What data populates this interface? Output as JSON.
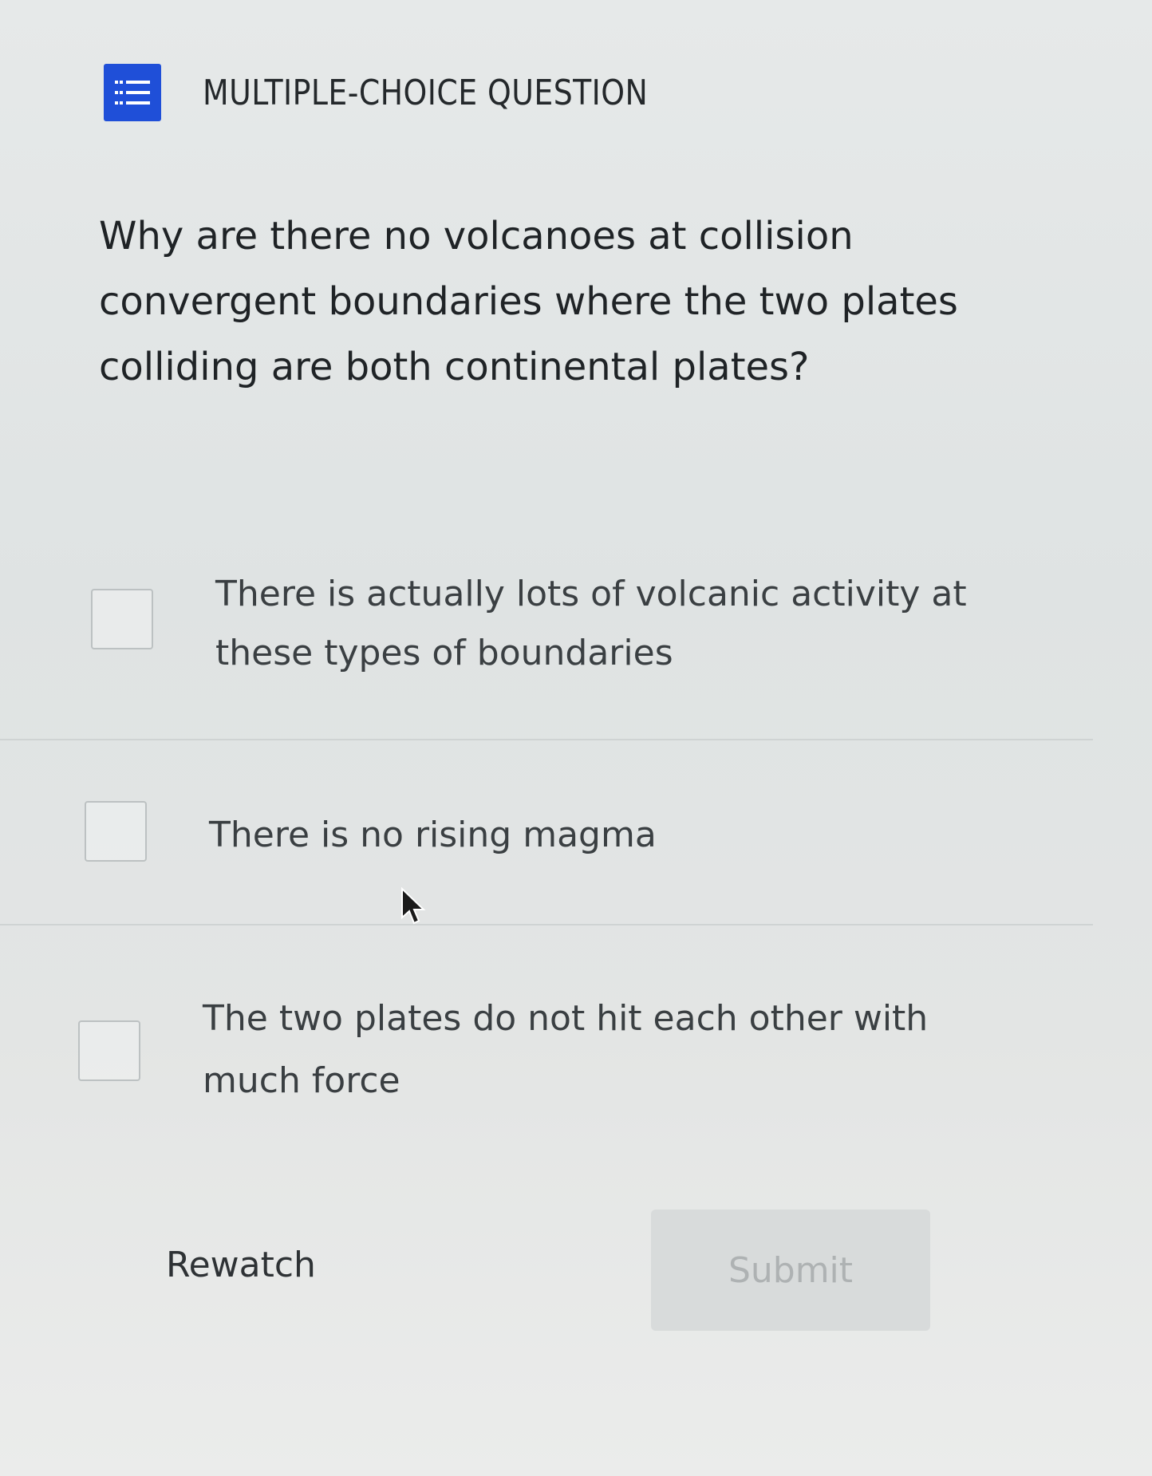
{
  "header": {
    "icon": "list-checks-icon",
    "title": "MULTIPLE-CHOICE QUESTION",
    "icon_color": "#1f4fd8"
  },
  "question": {
    "text": "Why are there no volcanoes at collision convergent boundaries where the two plates colliding are both continental plates?"
  },
  "options": [
    {
      "label": "There is actually lots of volcanic activity at these types of boundaries",
      "checked": false
    },
    {
      "label": "There is no rising magma",
      "checked": false
    },
    {
      "label": "The two plates do not hit each other with much force",
      "checked": false
    }
  ],
  "actions": {
    "rewatch_label": "Rewatch",
    "submit_label": "Submit",
    "submit_disabled": true
  }
}
